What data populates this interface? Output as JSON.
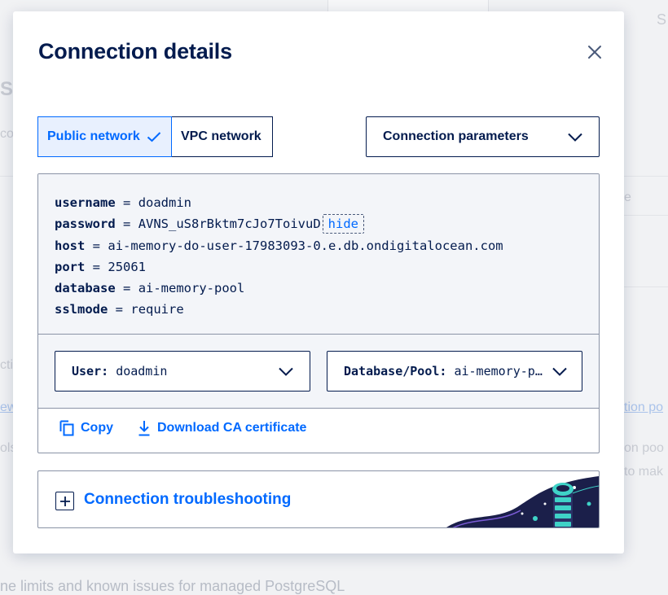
{
  "background": {
    "snippets": [
      "S",
      "S",
      "co",
      "e",
      "cti",
      "ew",
      "ols",
      "tion po",
      "on poo",
      "to mak",
      "ne limits and known issues for managed PostgreSQL"
    ]
  },
  "modal": {
    "title": "Connection details",
    "close_icon": "close-icon"
  },
  "network": {
    "public_label": "Public network",
    "vpc_label": "VPC network",
    "selected": "Public network"
  },
  "parameters_select": {
    "value": "Connection parameters"
  },
  "credentials": {
    "lines": [
      {
        "key": "username",
        "value": "doadmin"
      },
      {
        "key": "password",
        "value": "AVNS_uS8rBktm7cJo7ToivuD"
      },
      {
        "key": "host",
        "value": "ai-memory-do-user-17983093-0.e.db.ondigitalocean.com"
      },
      {
        "key": "port",
        "value": "25061"
      },
      {
        "key": "database",
        "value": "ai-memory-pool"
      },
      {
        "key": "sslmode",
        "value": "require"
      }
    ],
    "separator": "=",
    "hide_label": "hide",
    "user_select": {
      "label": "User:",
      "value": "doadmin"
    },
    "db_select": {
      "label": "Database/Pool:",
      "value": "ai-memory-pool"
    }
  },
  "actions": {
    "copy_label": "Copy",
    "download_label": "Download CA certificate"
  },
  "troubleshooting": {
    "label": "Connection troubleshooting"
  },
  "colors": {
    "accent": "#0069ff",
    "text": "#031b4e",
    "panel_bg": "#f3f5f9",
    "active_bg": "#e8f0fe",
    "art_bg": "#1b1f4a",
    "art_teal": "#3fd2c7"
  }
}
